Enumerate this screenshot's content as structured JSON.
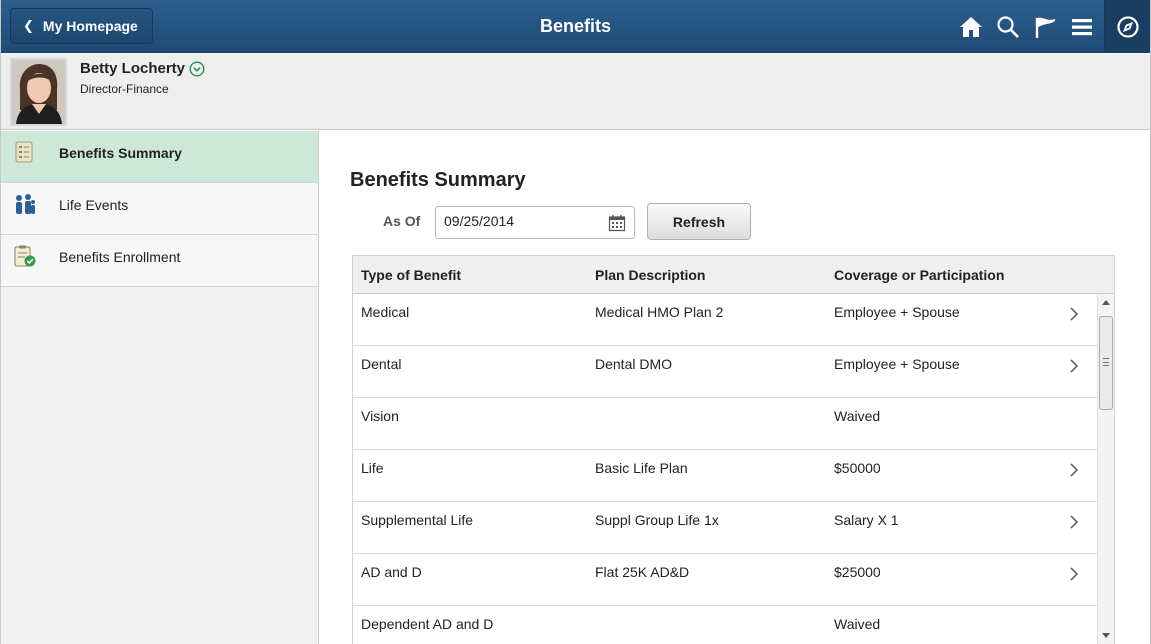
{
  "header": {
    "back_label": "My Homepage",
    "title": "Benefits",
    "icons": [
      "home-icon",
      "search-icon",
      "flag-icon",
      "menu-icon",
      "compass-icon"
    ]
  },
  "profile": {
    "name": "Betty Locherty",
    "job_title": "Director-Finance"
  },
  "sidebar": {
    "items": [
      {
        "label": "Benefits Summary",
        "icon": "benefits-summary-icon",
        "active": true
      },
      {
        "label": "Life Events",
        "icon": "life-events-icon",
        "active": false
      },
      {
        "label": "Benefits Enrollment",
        "icon": "benefits-enrollment-icon",
        "active": false
      }
    ]
  },
  "main": {
    "title": "Benefits Summary",
    "as_of_label": "As Of",
    "as_of_value": "09/25/2014",
    "refresh_label": "Refresh",
    "columns": [
      "Type of Benefit",
      "Plan Description",
      "Coverage or Participation"
    ],
    "rows": [
      {
        "type": "Medical",
        "plan": "Medical HMO Plan 2",
        "coverage": "Employee + Spouse",
        "has_detail": true
      },
      {
        "type": "Dental",
        "plan": "Dental DMO",
        "coverage": "Employee + Spouse",
        "has_detail": true
      },
      {
        "type": "Vision",
        "plan": "",
        "coverage": "Waived",
        "has_detail": false
      },
      {
        "type": "Life",
        "plan": "Basic Life Plan",
        "coverage": "$50000",
        "has_detail": true
      },
      {
        "type": "Supplemental Life",
        "plan": "Suppl Group Life 1x",
        "coverage": "Salary X 1",
        "has_detail": true
      },
      {
        "type": "AD and D",
        "plan": "Flat 25K AD&D",
        "coverage": "$25000",
        "has_detail": true
      },
      {
        "type": "Dependent AD and D",
        "plan": "",
        "coverage": "Waived",
        "has_detail": false
      }
    ]
  },
  "colors": {
    "banner": "#245282",
    "active_nav": "#cde8d9"
  }
}
